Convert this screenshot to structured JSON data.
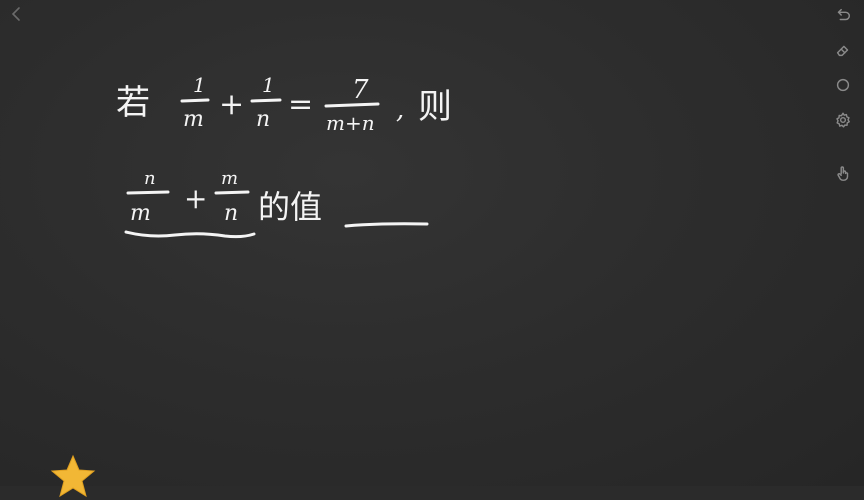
{
  "board": {
    "problem": {
      "if_word": "若",
      "frac1": {
        "num": "1",
        "den": "m"
      },
      "plus": "+",
      "frac2": {
        "num": "1",
        "den": "n"
      },
      "equals": "=",
      "frac3": {
        "num": "7",
        "den": "m+n"
      },
      "comma": ",",
      "then_word": "则",
      "frac4": {
        "num": "n",
        "den": "m"
      },
      "frac5": {
        "num": "m",
        "den": "n"
      },
      "value_words": "的值"
    }
  },
  "toolbar": {
    "icons": [
      "undo-icon",
      "eraser-icon",
      "circle-icon",
      "settings-icon",
      "hand-pointer-icon"
    ]
  },
  "colors": {
    "board": "#2b2b2b",
    "chalk": "#f4f4f4",
    "icon": "#8a8a8a",
    "star": "#f2b735"
  }
}
